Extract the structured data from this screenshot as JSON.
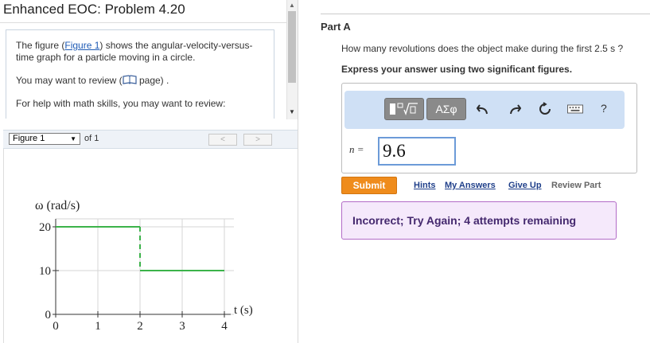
{
  "page_title": "Enhanced EOC: Problem 4.20",
  "intro": {
    "figure_sentence_prefix": "The figure (",
    "figure_link": "Figure 1",
    "figure_sentence_suffix": ") shows the angular-velocity-versus-time graph for a particle moving in a circle.",
    "review_prefix": "You may want to review (",
    "review_link": "page",
    "review_suffix": ") .",
    "math_help": "For help with math skills, you may want to review:"
  },
  "figure_nav": {
    "selected": "Figure 1",
    "of_text": "of 1",
    "prev": "<",
    "next": ">"
  },
  "chart_data": {
    "type": "line",
    "ylabel": "ω (rad/s)",
    "xlabel": "t (s)",
    "x_ticks": [
      "0",
      "1",
      "2",
      "3",
      "4"
    ],
    "y_ticks": [
      "0",
      "10",
      "20"
    ],
    "xlim": [
      0,
      4
    ],
    "ylim": [
      0,
      20
    ],
    "series": [
      {
        "x": [
          0,
          2,
          2,
          4
        ],
        "y": [
          20,
          20,
          10,
          10
        ]
      }
    ],
    "dashed_drop": {
      "x": 2,
      "from": 20,
      "to": 10
    },
    "line_color": "#3cb34a",
    "grid": true
  },
  "part": {
    "title": "Part A",
    "question": "How many revolutions does the object make during the first 2.5 s ?",
    "instruction": "Express your answer using two significant figures."
  },
  "toolbar": {
    "template_icon": "templates-icon",
    "symbols_label": "ΑΣφ",
    "undo_icon": "undo-icon",
    "redo_icon": "redo-icon",
    "reset_icon": "reset-icon",
    "keyboard_icon": "keyboard-icon",
    "help_label": "?"
  },
  "answer": {
    "label": "n =",
    "value": "9.6"
  },
  "actions": {
    "submit": "Submit",
    "hints": "Hints",
    "my_answers": "My Answers",
    "give_up": "Give Up",
    "review_part": "Review Part"
  },
  "feedback": "Incorrect; Try Again; 4 attempts remaining",
  "colors": {
    "submit": "#ef8c1c",
    "feedback_bg": "#f5e9fb",
    "feedback_border": "#b36cc7",
    "toolbar_bg": "#cfe0f5"
  }
}
